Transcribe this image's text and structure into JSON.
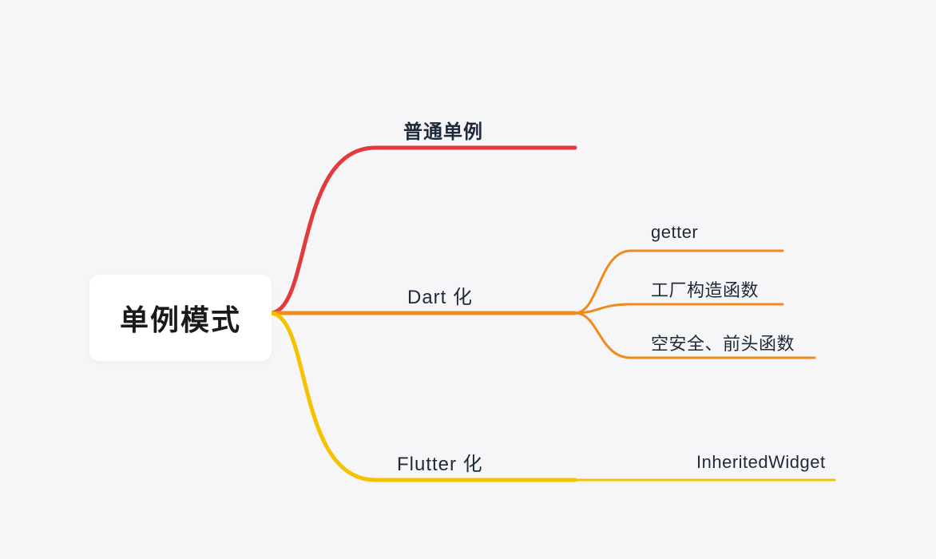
{
  "root": {
    "label": "单例模式"
  },
  "branches": [
    {
      "label": "普通单例",
      "color": "#e23b3b",
      "children": []
    },
    {
      "label": "Dart 化",
      "color": "#f08a1c",
      "children": [
        {
          "label": "getter"
        },
        {
          "label": "工厂构造函数"
        },
        {
          "label": "空安全、前头函数"
        }
      ]
    },
    {
      "label": "Flutter 化",
      "color": "#f5c200",
      "children": [
        {
          "label": "InheritedWidget"
        }
      ]
    }
  ]
}
